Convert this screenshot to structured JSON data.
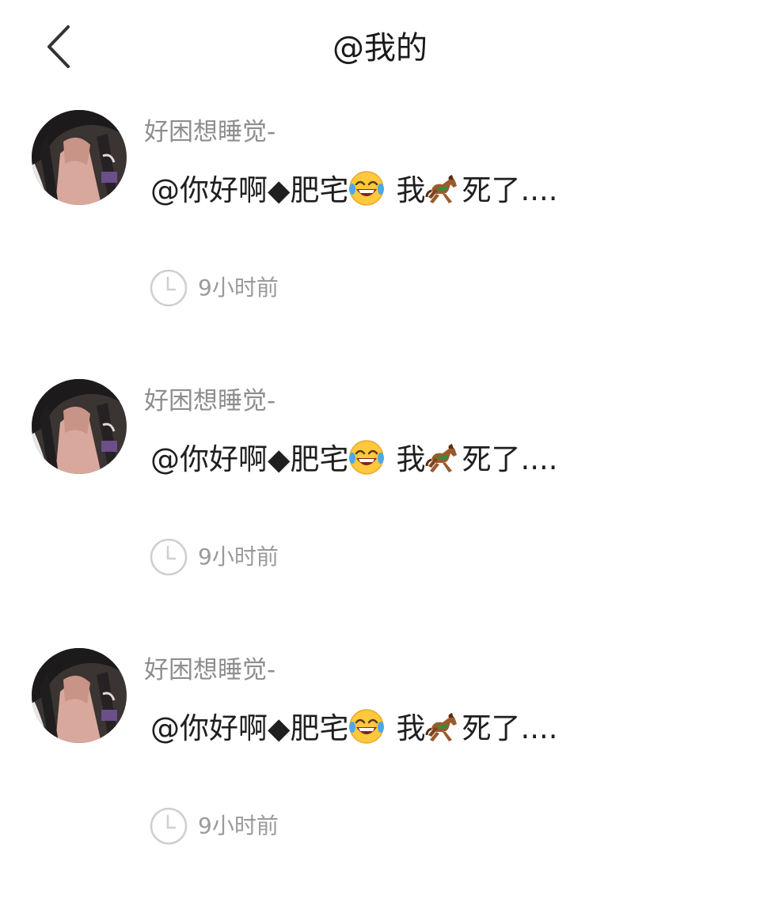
{
  "header": {
    "title": "@我的",
    "back_icon": "chevron-left-icon"
  },
  "colors": {
    "title": "#1a1a1a",
    "username": "#8e8e8e",
    "content": "#1f1f1f",
    "time": "#9a9a9a",
    "background": "#ffffff"
  },
  "mentions": [
    {
      "avatar": "avatar-image",
      "username": "好困想睡觉-",
      "content_prefix": "@你好啊◆肥宅",
      "emoji_1": "tears-of-joy-emoji",
      "content_middle": "我",
      "emoji_2": "horse-emoji",
      "content_suffix": "死了....",
      "time": "9小时前"
    },
    {
      "avatar": "avatar-image",
      "username": "好困想睡觉-",
      "content_prefix": "@你好啊◆肥宅",
      "emoji_1": "tears-of-joy-emoji",
      "content_middle": "我",
      "emoji_2": "horse-emoji",
      "content_suffix": "死了....",
      "time": "9小时前"
    },
    {
      "avatar": "avatar-image",
      "username": "好困想睡觉-",
      "content_prefix": "@你好啊◆肥宅",
      "emoji_1": "tears-of-joy-emoji",
      "content_middle": "我",
      "emoji_2": "horse-emoji",
      "content_suffix": "死了....",
      "time": "9小时前"
    }
  ]
}
